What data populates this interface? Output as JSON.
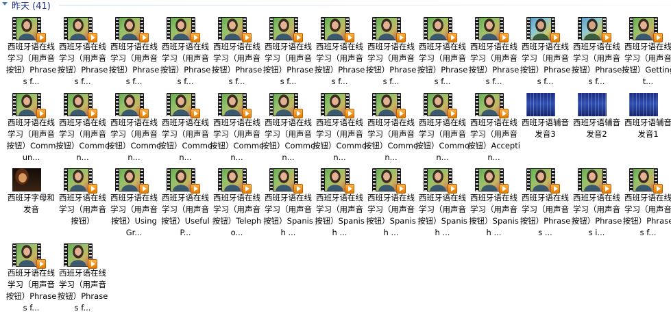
{
  "group": {
    "title": "昨天 (41)"
  },
  "items": [
    {
      "label": "西班牙语在线学习（用声音按钮）Phrases f...",
      "thumb": "teacher",
      "play": true
    },
    {
      "label": "西班牙语在线学习（用声音按钮）Phrases f...",
      "thumb": "teacher",
      "play": true
    },
    {
      "label": "西班牙语在线学习（用声音按钮）Phrases f...",
      "thumb": "teacher",
      "play": true
    },
    {
      "label": "西班牙语在线学习（用声音按钮）Phrases f...",
      "thumb": "teacher",
      "play": true
    },
    {
      "label": "西班牙语在线学习（用声音按钮）Phrases f...",
      "thumb": "teacher",
      "play": true
    },
    {
      "label": "西班牙语在线学习（用声音按钮）Phrases f...",
      "thumb": "teacher",
      "play": true
    },
    {
      "label": "西班牙语在线学习（用声音按钮）Phrases f...",
      "thumb": "teacher",
      "play": true
    },
    {
      "label": "西班牙语在线学习（用声音按钮）Phrases f...",
      "thumb": "teacher",
      "play": true
    },
    {
      "label": "西班牙语在线学习（用声音按钮）Phrases f...",
      "thumb": "teacher",
      "play": true
    },
    {
      "label": "西班牙语在线学习（用声音按钮）Phrases f...",
      "thumb": "teacher",
      "play": true
    },
    {
      "label": "西班牙语在线学习（用声音按钮）Phrases f...",
      "thumb": "teacher2",
      "play": true
    },
    {
      "label": "西班牙语在线学习（用声音按钮）Phrases f...",
      "thumb": "teacher2",
      "play": true
    },
    {
      "label": "西班牙语在线学习（用声音按钮）Getting t...",
      "thumb": "teacher",
      "play": true
    },
    {
      "label": "西班牙语在线学习（用声音按钮）Commun...",
      "thumb": "teacher",
      "play": true
    },
    {
      "label": "西班牙语在线学习（用声音按钮）Common...",
      "thumb": "teacher",
      "play": true
    },
    {
      "label": "西班牙语在线学习（用声音按钮）Common...",
      "thumb": "teacher",
      "play": true
    },
    {
      "label": "西班牙语在线学习（用声音按钮）Common...",
      "thumb": "teacher",
      "play": true
    },
    {
      "label": "西班牙语在线学习（用声音按钮）Common...",
      "thumb": "teacher",
      "play": true
    },
    {
      "label": "西班牙语在线学习（用声音按钮）Common...",
      "thumb": "teacher",
      "play": true
    },
    {
      "label": "西班牙语在线学习（用声音按钮）Common...",
      "thumb": "teacher",
      "play": true
    },
    {
      "label": "西班牙语在线学习（用声音按钮）Common...",
      "thumb": "teacher",
      "play": true
    },
    {
      "label": "西班牙语在线学习（用声音按钮）Common...",
      "thumb": "teacher",
      "play": true
    },
    {
      "label": "西班牙语在线学习（用声音按钮）Acceptin...",
      "thumb": "teacher",
      "play": true
    },
    {
      "label": "西班牙语辅音发音3",
      "thumb": "blue",
      "play": false
    },
    {
      "label": "西班牙语辅音发音2",
      "thumb": "blue",
      "play": false
    },
    {
      "label": "西班牙语辅音发音1",
      "thumb": "blue",
      "play": false
    },
    {
      "label": "西班牙字母和发音",
      "thumb": "portrait",
      "play": false
    },
    {
      "label": "西班牙语在线学习（用声音按钮）",
      "thumb": "teacher",
      "play": true
    },
    {
      "label": "西班牙语在线学习（用声音按钮）Using Gr...",
      "thumb": "teacher",
      "play": true
    },
    {
      "label": "西班牙语在线学习（用声音按钮）Useful P...",
      "thumb": "teacher",
      "play": true
    },
    {
      "label": "西班牙语在线学习（用声音按钮）Telepho...",
      "thumb": "teacher",
      "play": true
    },
    {
      "label": "西班牙语在线学习（用声音按钮）Spanish ...",
      "thumb": "teacher",
      "play": true
    },
    {
      "label": "西班牙语在线学习（用声音按钮）Spanish ...",
      "thumb": "teacher",
      "play": true
    },
    {
      "label": "西班牙语在线学习（用声音按钮）Spanish ...",
      "thumb": "teacher",
      "play": true
    },
    {
      "label": "西班牙语在线学习（用声音按钮）Spanish ...",
      "thumb": "teacher",
      "play": true
    },
    {
      "label": "西班牙语在线学习（用声音按钮）Spanish ...",
      "thumb": "teacher",
      "play": true
    },
    {
      "label": "西班牙语在线学习（用声音按钮）Phrases ...",
      "thumb": "teacher",
      "play": true
    },
    {
      "label": "西班牙语在线学习（用声音按钮）Phrases i...",
      "thumb": "teacher",
      "play": true
    },
    {
      "label": "西班牙语在线学习（用声音按钮）Phrases f...",
      "thumb": "teacher",
      "play": true
    },
    {
      "label": "西班牙语在线学习（用声音按钮）Phrases f...",
      "thumb": "teacher",
      "play": true
    },
    {
      "label": "西班牙语在线学习（用声音按钮）Phrases f...",
      "thumb": "teacher",
      "play": true
    }
  ]
}
